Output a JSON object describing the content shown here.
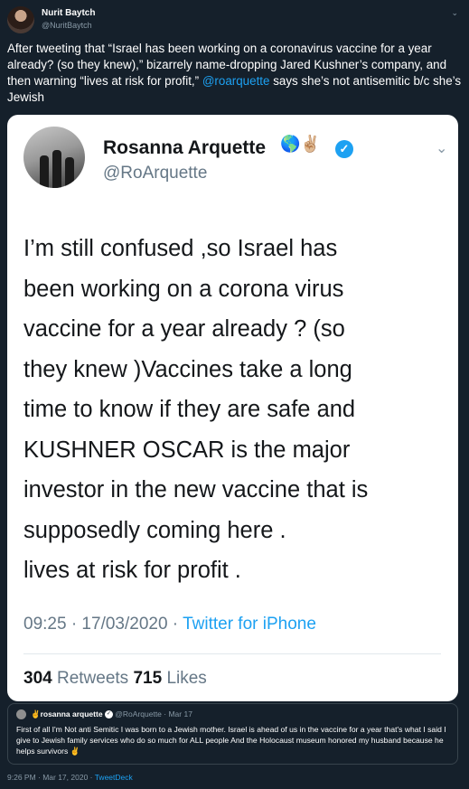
{
  "author": {
    "name": "Nurit Baytch",
    "handle": "@NuritBaytch"
  },
  "tweet": {
    "text_main": "After tweeting that “Israel has been working on a coronavirus vaccine for a year already? (so they knew),” bizarrely name-dropping Jared Kushner’s company, and then warning “lives at risk for profit,” ",
    "mention": "@roarquette",
    "text_end": " says she’s not antisemitic b/c she’s Jewish"
  },
  "embedded": {
    "name": "Rosanna Arquette",
    "name_emoji": "🌎✌🏼",
    "handle": "@RoArquette",
    "body_lines": [
      "I’m still confused ,so Israel has",
      "been working on a corona virus",
      "vaccine for a year already ? (so",
      "they knew )Vaccines take a long",
      "time to know if they are safe and",
      "KUSHNER OSCAR is the major",
      "investor in the new vaccine that is",
      "supposedly coming here .",
      "lives at risk for profit ."
    ],
    "time_date": "09:25 · 17/03/2020 · ",
    "via": "Twitter for iPhone",
    "retweets_count": "304",
    "retweets_label": " Retweets  ",
    "likes_count": "715",
    "likes_label": " Likes"
  },
  "quote": {
    "name": "✌rosanna arquette",
    "meta": " @RoArquette · Mar 17",
    "text": "First of all I'm Not anti Semitic  I was born to a Jewish mother. Israel is ahead of us in the vaccine for a year that's what I said I give to Jewish family services who do so much for ALL people And the Holocaust museum honored my husband because he helps survivors  ✌"
  },
  "footer": {
    "time": "9:26 PM · Mar 17, 2020 · ",
    "via": "TweetDeck"
  }
}
